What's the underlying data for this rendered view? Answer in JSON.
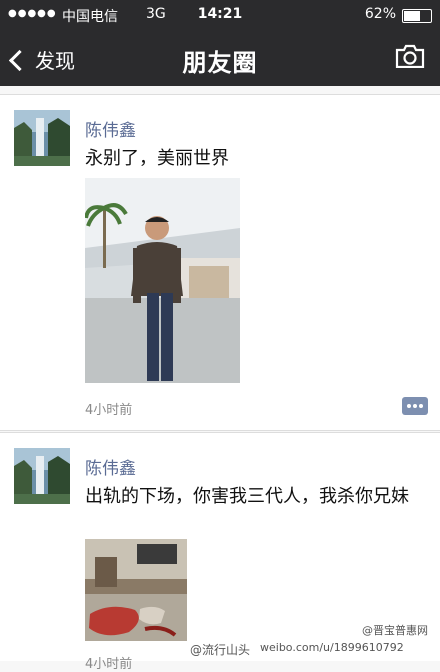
{
  "status_bar": {
    "signal_dots": "●●●●●",
    "carrier": "中国电信",
    "network": "3G",
    "time": "14:21",
    "battery": "62%"
  },
  "nav": {
    "back_label": "发现",
    "title": "朋友圈",
    "camera_icon": "camera-icon"
  },
  "posts": [
    {
      "author": "陈伟鑫",
      "text": "永别了，美丽世界",
      "time": "4小时前"
    },
    {
      "author": "陈伟鑫",
      "text": "出轨的下场，你害我三代人，我杀你兄妹",
      "time": "4小时前"
    }
  ],
  "watermarks": {
    "left": "@流行山头",
    "center": "weibo.com/u/1899610792",
    "right": "@晋宝普惠网"
  }
}
